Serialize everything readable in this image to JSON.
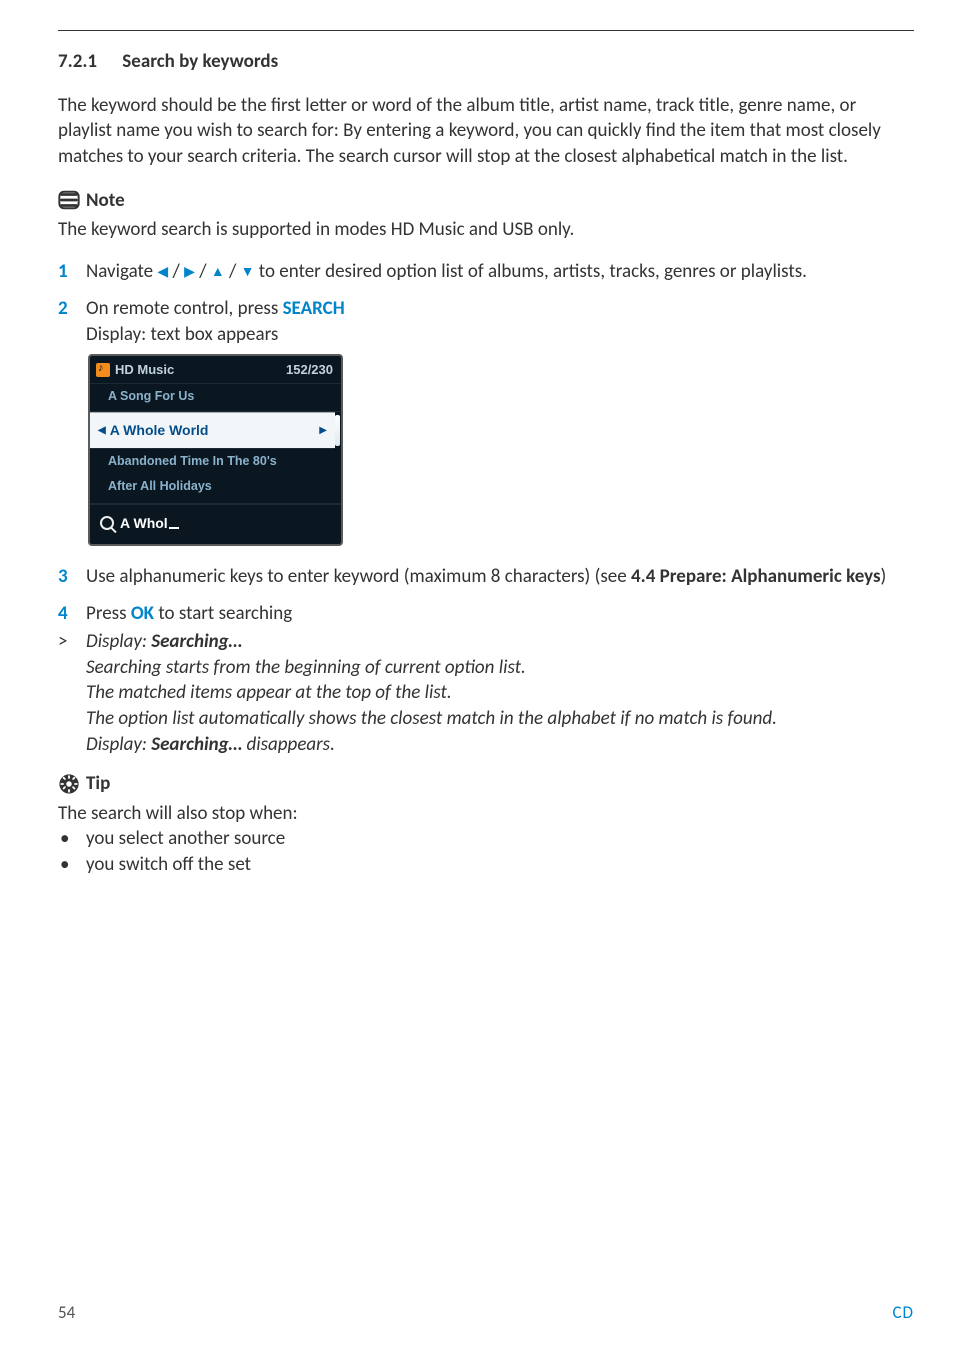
{
  "section": {
    "num": "7.2.1",
    "title": "Search by keywords"
  },
  "intro": "The keyword should be the first letter or word of the album title, artist name, track title, genre name, or playlist name you wish to search for: By entering a keyword, you can quickly find the item that most closely matches to your search criteria. The search cursor will stop at the closest alphabetical match in the list.",
  "note": {
    "label": "Note",
    "text": "The keyword search is supported in modes HD Music and USB only."
  },
  "steps": {
    "s1": {
      "n": "1",
      "pre": "Navigate ",
      "post": " to enter desired option list of albums, artists, tracks, genres or playlists."
    },
    "s2": {
      "n": "2",
      "pre": "On remote control, press ",
      "btn": "SEARCH",
      "sub": "Display: text box appears"
    },
    "s3": {
      "n": "3",
      "pre": "Use alphanumeric keys to enter keyword (maximum 8 characters) (see ",
      "ref": "4.4 Prepare: Alphanumeric keys",
      "post": ")"
    },
    "s4": {
      "n": "4",
      "pre": "Press ",
      "btn": "OK",
      "post": " to start searching"
    }
  },
  "screenshot": {
    "header": "HD Music",
    "counter": "152/230",
    "items": {
      "i0": "A Song For Us",
      "active": "A Whole World",
      "i2": "Abandoned Time In The 80's",
      "i3": "After All Holidays"
    },
    "search": "A Whol"
  },
  "results": {
    "gt": ">",
    "l1a": "Display: ",
    "l1b": "Searching…",
    "l2": "Searching starts from the beginning of current option list.",
    "l3": "The matched items appear at the top of the list.",
    "l4": "The option list automatically shows the closest match in the alphabet if no match is found.",
    "l5a": "Display: ",
    "l5b": "Searching…",
    "l5c": " disappears."
  },
  "tip": {
    "label": "Tip",
    "text": "The search will also stop when:",
    "b1": "you select another source",
    "b2": "you switch off the set"
  },
  "footer": {
    "page": "54",
    "label": "CD"
  },
  "arrows": {
    "left": "◀",
    "right": "▶",
    "up": "▲",
    "down": "▼",
    "sep": " / "
  }
}
